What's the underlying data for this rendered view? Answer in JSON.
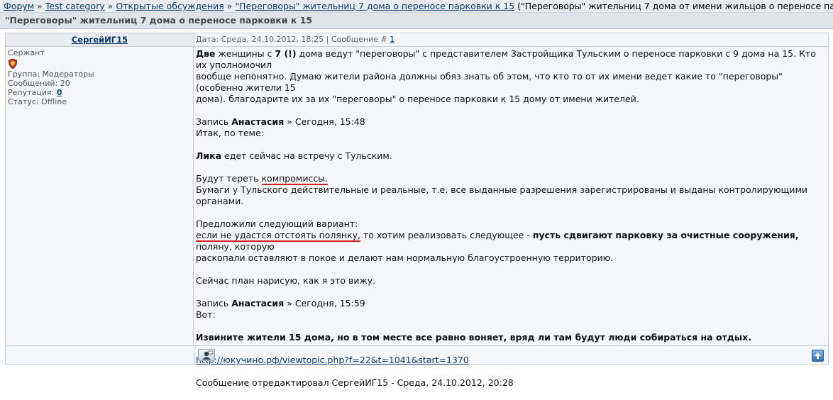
{
  "breadcrumb": {
    "items": [
      "Форум",
      "Test category",
      "Открытые обсуждения",
      "\"Переговоры\" жительниц 7 дома о переносе парковки к 15"
    ],
    "separator": "»",
    "current": "(\"Переговоры\" жительниц 7 дома от имени жильцов о переносе па)"
  },
  "thread": {
    "title": "\"Переговоры\" жительниц 7 дома о переносе парковки к 15"
  },
  "post": {
    "author": "СергейИГ15",
    "meta_prefix": "Дата: Среда, 24.10.2012, 18:25 | Сообщение #",
    "number": "1",
    "profile": {
      "rank": "Сержант",
      "group": "Группа: Модераторы",
      "messages": "Сообщений: 20",
      "reputation_label": "Репутация:",
      "reputation_value": "0",
      "status": "Статус: Offline"
    },
    "body": {
      "p1_bold1": "Две",
      "p1_t1": " женщины с ",
      "p1_bold2": "7 (!)",
      "p1_t2": " дома ведут \"переговоры\" с представителем Застройщика Тульским о переносе парковки с 9 дома на 15. Кто их уполномочил",
      "p1_line2": "вообще непонятно. Думаю жители района должны обяз знать об этом, что кто то от их имени ведет какие то \"переговоры\" (особенно жители 15",
      "p1_line3": "дома). благодарите их за их \"переговоры\" о переносе парковки к 15 дому от имени жителей.",
      "q1_prefix": "Запись ",
      "q1_author": "Анастасия",
      "q1_suffix": " » Сегодня, 15:48",
      "q1_intro": "Итак, по теме:",
      "lika_bold": "Лика",
      "lika_text": " едет сейчас на встречу с Тульским.",
      "comp_text": "Будут тереть ",
      "comp_word": "компромиссы.",
      "papers": "Бумаги у Тульского действительные и реальные, т.е. все выданные разрешения зарегистрированы и выданы контролирующими органами.",
      "offer": "Предложили следующий вариант:",
      "offer_red": "если не удастся отстоять полянку,",
      "offer_t1": " то хотим реализовать следующее - ",
      "offer_bold": "пусть сдвигают парковку за очистные сооружения,",
      "offer_t2": " поляну, которую",
      "offer_line2": "раскопали оставляют в покое и делают нам нормальную благоустроенную территорию.",
      "plan": "Сейчас план нарисую, как я это вижу.",
      "q2_prefix": "Запись ",
      "q2_author": "Анастасия",
      "q2_suffix": " » Сегодня, 15:59",
      "q2_intro": "Вот:",
      "sorry": "Извините жители 15 дома, но в том месте все равно воняет, вряд ли там будут люди собираться на отдых.",
      "link": "http://юкучино.рф/viewtopic.php?f=22&t=1041&start=1370",
      "edited": "Сообщение отредактировал СергейИГ15 - Среда, 24.10.2012, 20:28"
    }
  },
  "icons": {
    "rank": "shield-rank-icon",
    "pm": "send-message-icon",
    "top": "arrow-up-icon"
  },
  "colors": {
    "link": "#0b3a6e",
    "underline": "#d42020",
    "post_bg": "#f4f6f9"
  }
}
